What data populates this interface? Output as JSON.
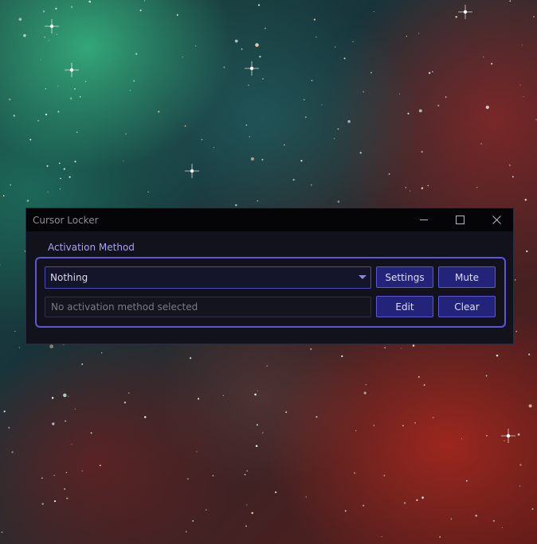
{
  "window": {
    "title": "Cursor Locker",
    "controls": {
      "minimize": "minimize-icon",
      "maximize": "maximize-icon",
      "close": "close-icon"
    }
  },
  "activation": {
    "group_label": "Activation Method",
    "selected_method": "Nothing",
    "status_text": "No activation method selected",
    "settings_label": "Settings",
    "mute_label": "Mute",
    "edit_label": "Edit",
    "clear_label": "Clear"
  },
  "colors": {
    "accent": "#5d56d6",
    "button_bg": "#23237a",
    "label": "#a7a3f0",
    "window_bg": "#12121c",
    "titlebar_bg": "#050507"
  }
}
